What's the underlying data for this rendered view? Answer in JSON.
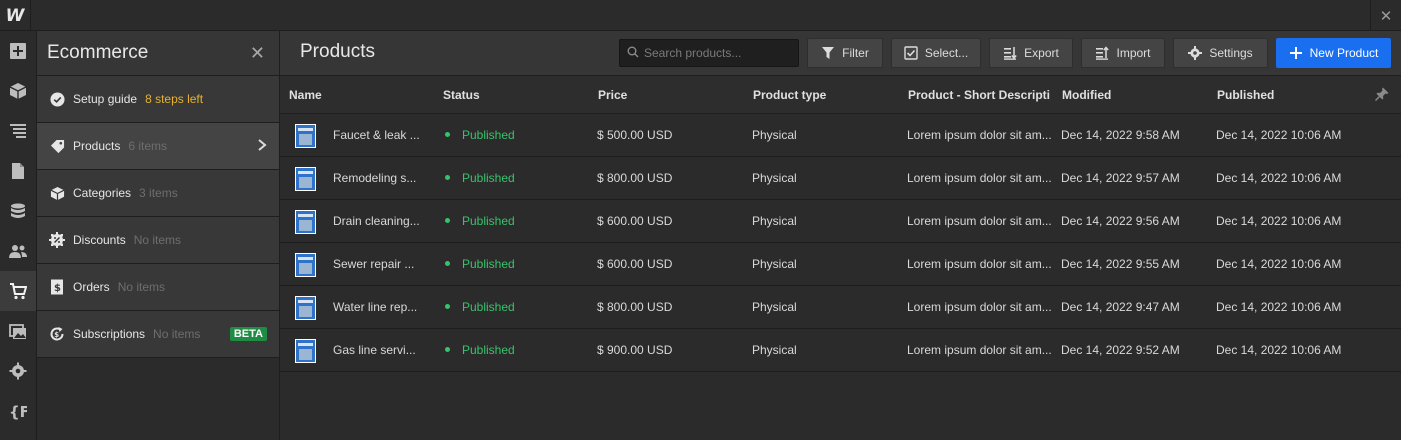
{
  "app": {
    "logo": "W",
    "close": "✕"
  },
  "rail": {
    "items": [
      {
        "name": "add-panel-icon"
      },
      {
        "name": "components-icon"
      },
      {
        "name": "navigator-icon"
      },
      {
        "name": "pages-icon"
      },
      {
        "name": "cms-icon"
      },
      {
        "name": "users-icon"
      },
      {
        "name": "ecommerce-icon"
      },
      {
        "name": "assets-icon"
      },
      {
        "name": "settings-icon"
      },
      {
        "name": "apps-icon"
      }
    ]
  },
  "panel": {
    "title": "Ecommerce",
    "close": "✕",
    "items": [
      {
        "label": "Setup guide",
        "count": "8 steps left"
      },
      {
        "label": "Products",
        "count": "6 items"
      },
      {
        "label": "Categories",
        "count": "3 items"
      },
      {
        "label": "Discounts",
        "count": "No items"
      },
      {
        "label": "Orders",
        "count": "No items"
      },
      {
        "label": "Subscriptions",
        "count": "No items",
        "badge": "BETA"
      }
    ]
  },
  "main": {
    "title": "Products",
    "search_placeholder": "Search products...",
    "toolbar": {
      "filter": "Filter",
      "select": "Select...",
      "export": "Export",
      "import": "Import",
      "settings": "Settings",
      "new_product": "New Product"
    }
  },
  "table": {
    "columns": [
      "Name",
      "Status",
      "Price",
      "Product type",
      "Product - Short Descripti",
      "Modified",
      "Published"
    ],
    "rows": [
      {
        "name": "Faucet & leak ...",
        "status": "Published",
        "price": "$ 500.00 USD",
        "type": "Physical",
        "desc": "Lorem ipsum dolor sit am...",
        "modified": "Dec 14, 2022 9:58 AM",
        "published": "Dec 14, 2022 10:06 AM"
      },
      {
        "name": "Remodeling s...",
        "status": "Published",
        "price": "$ 800.00 USD",
        "type": "Physical",
        "desc": "Lorem ipsum dolor sit am...",
        "modified": "Dec 14, 2022 9:57 AM",
        "published": "Dec 14, 2022 10:06 AM"
      },
      {
        "name": "Drain cleaning...",
        "status": "Published",
        "price": "$ 600.00 USD",
        "type": "Physical",
        "desc": "Lorem ipsum dolor sit am...",
        "modified": "Dec 14, 2022 9:56 AM",
        "published": "Dec 14, 2022 10:06 AM"
      },
      {
        "name": "Sewer repair ...",
        "status": "Published",
        "price": "$ 600.00 USD",
        "type": "Physical",
        "desc": "Lorem ipsum dolor sit am...",
        "modified": "Dec 14, 2022 9:55 AM",
        "published": "Dec 14, 2022 10:06 AM"
      },
      {
        "name": "Water line rep...",
        "status": "Published",
        "price": "$ 800.00 USD",
        "type": "Physical",
        "desc": "Lorem ipsum dolor sit am...",
        "modified": "Dec 14, 2022 9:47 AM",
        "published": "Dec 14, 2022 10:06 AM"
      },
      {
        "name": "Gas line servi...",
        "status": "Published",
        "price": "$ 900.00 USD",
        "type": "Physical",
        "desc": "Lorem ipsum dolor sit am...",
        "modified": "Dec 14, 2022 9:52 AM",
        "published": "Dec 14, 2022 10:06 AM"
      }
    ]
  },
  "colors": {
    "accent": "#1a6ff0",
    "published": "#35c46a",
    "warning": "#e8b12f",
    "beta": "#1f8c44"
  }
}
